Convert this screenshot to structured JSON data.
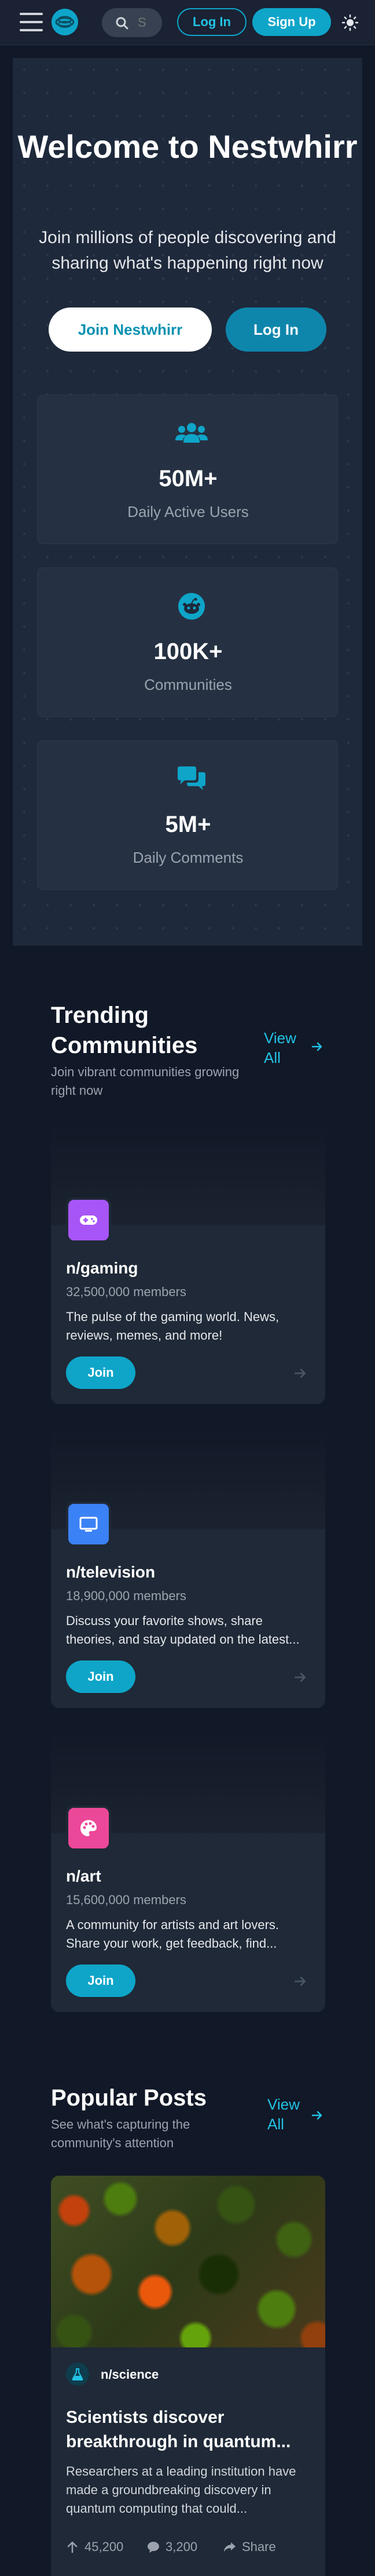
{
  "header": {
    "search_placeholder": "S",
    "login_label": "Log In",
    "signup_label": "Sign Up",
    "icons": [
      "menu-icon",
      "logo-icon",
      "search-icon",
      "theme-toggle-icon"
    ]
  },
  "hero": {
    "title": "Welcome to Nestwhirr",
    "subtitle": "Join millions of people discovering and sharing what's happening right now",
    "join_label": "Join Nestwhirr",
    "login_label": "Log In",
    "stats": [
      {
        "value": "50M+",
        "label": "Daily Active Users",
        "icon": "users-icon"
      },
      {
        "value": "100K+",
        "label": "Communities",
        "icon": "reddit-alien-icon"
      },
      {
        "value": "5M+",
        "label": "Daily Comments",
        "icon": "comments-icon"
      }
    ]
  },
  "trending": {
    "title": "Trending Communities",
    "subtitle": "Join vibrant communities growing right now",
    "view_all": "View All",
    "communities": [
      {
        "name": "n/gaming",
        "members": "32,500,000 members",
        "description": "The pulse of the gaming world. News, reviews, memes, and more!",
        "join_label": "Join",
        "icon": "gamepad-icon",
        "color": "#a855f7"
      },
      {
        "name": "n/television",
        "members": "18,900,000 members",
        "description": "Discuss your favorite shows, share theories, and stay updated on the latest...",
        "join_label": "Join",
        "icon": "tv-icon",
        "color": "#3b82f6"
      },
      {
        "name": "n/art",
        "members": "15,600,000 members",
        "description": "A community for artists and art lovers. Share your work, get feedback, find...",
        "join_label": "Join",
        "icon": "palette-icon",
        "color": "#ec4899"
      }
    ]
  },
  "popular": {
    "title": "Popular Posts",
    "subtitle": "See what's capturing the community's attention",
    "view_all": "View All",
    "posts": [
      {
        "subreddit": "n/science",
        "title": "Scientists discover breakthrough in quantum...",
        "excerpt": "Researchers at a leading institution have made a groundbreaking discovery in quantum computing that could...",
        "upvotes": "45,200",
        "comments": "3,200",
        "share_label": "Share",
        "image": "autumn-forest-aerial-photo"
      }
    ]
  },
  "colors": {
    "accent": "#0ea5c9",
    "background": "#111827",
    "card": "#1f2937"
  }
}
